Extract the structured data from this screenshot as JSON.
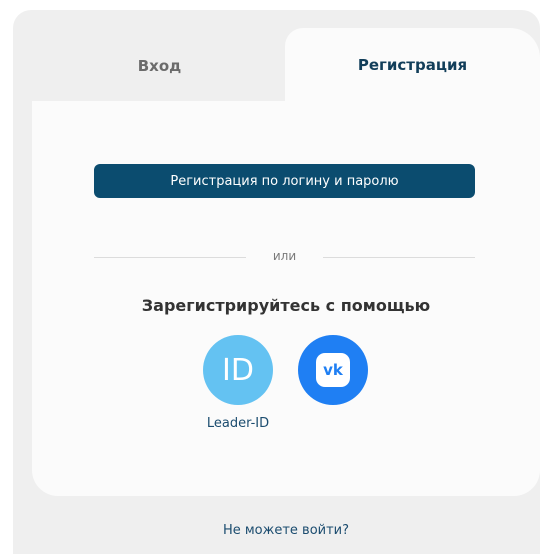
{
  "tabs": {
    "login_label": "Вход",
    "register_label": "Регистрация"
  },
  "register": {
    "login_password_button": "Регистрация по логину и паролю",
    "divider_text": "или",
    "social_title": "Зарегистрируйтесь с помощью",
    "leader_id_label": "Leader-ID",
    "leader_id_glyph": "ID",
    "vk_glyph": "vk"
  },
  "footer": {
    "cant_login": "Не можете войти?"
  },
  "colors": {
    "primary": "#0b4c6f",
    "leader_id": "#64c2f2",
    "vk": "#1f7ff3",
    "link": "#1b4c6f"
  },
  "icons": {
    "leader_id": "leader-id-icon",
    "vk": "vk-icon"
  }
}
